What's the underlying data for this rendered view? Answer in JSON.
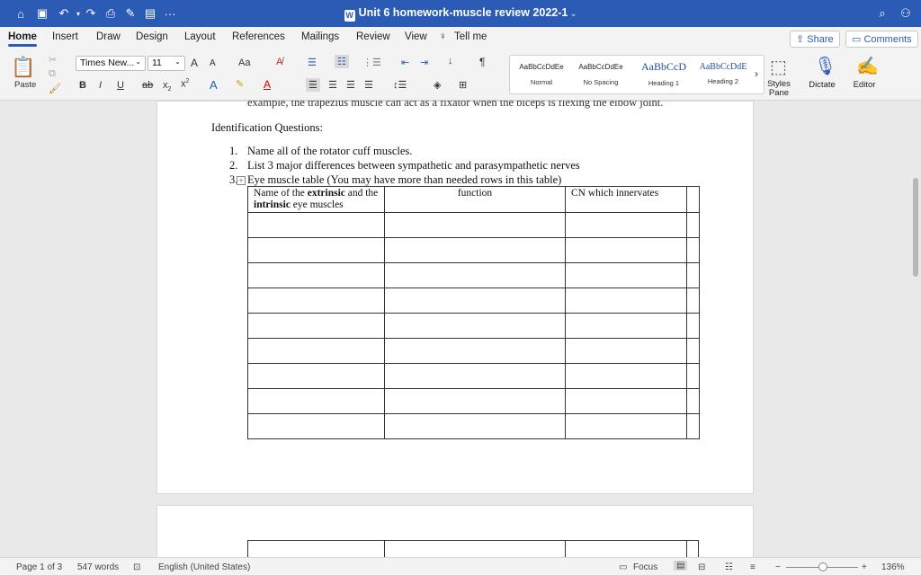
{
  "window": {
    "title": "Unit 6 homework-muscle review 2022-1"
  },
  "quick_access": {
    "icons": [
      "home-icon",
      "save-icon",
      "undo-icon",
      "redo-icon",
      "print-icon",
      "draw-icon",
      "format-icon",
      "more-icon"
    ],
    "more_label": "···"
  },
  "tabs": [
    "Home",
    "Insert",
    "Draw",
    "Design",
    "Layout",
    "References",
    "Mailings",
    "Review",
    "View"
  ],
  "tell_me": "Tell me",
  "share_label": "Share",
  "comments_label": "Comments",
  "ribbon": {
    "paste_label": "Paste",
    "font_name": "Times New...",
    "font_size": "11",
    "bold": "B",
    "italic": "I",
    "underline": "U",
    "strike": "ab",
    "subscript": "x",
    "superscript": "x",
    "grow": "A",
    "shrink": "A",
    "change_case": "Aa",
    "styles": [
      {
        "sample": "AaBbCcDdEe",
        "name": "Normal"
      },
      {
        "sample": "AaBbCcDdEe",
        "name": "No Spacing"
      },
      {
        "sample": "AaBbCcD",
        "name": "Heading 1"
      },
      {
        "sample": "AaBbCcDdE",
        "name": "Heading 2"
      }
    ],
    "styles_pane_label": "Styles\nPane",
    "dictate_label": "Dictate",
    "editor_label": "Editor",
    "pilcrow": "¶"
  },
  "document": {
    "cut_line": "example, the trapezius muscle can act as a fixator when the biceps is flexing the elbow joint.",
    "heading": "Identification Questions:",
    "questions": [
      {
        "num": "1.",
        "text": "Name all of the rotator cuff muscles."
      },
      {
        "num": "2.",
        "text": "List 3 major differences between sympathetic and parasympathetic nerves"
      },
      {
        "num": "3.",
        "text": "Eye muscle table (You may have more than needed rows in this table)"
      }
    ],
    "table": {
      "header_col1_part1": "Name of the ",
      "header_col1_bold1": "extrinsic",
      "header_col1_part2": " and the ",
      "header_col1_bold2": "intrinsic",
      "header_col1_part3": " eye muscles",
      "header_col2": "function",
      "header_col3": "CN which innervates",
      "empty_rows": 9
    }
  },
  "status": {
    "page": "Page 1 of 3",
    "words": "547 words",
    "language": "English (United States)",
    "focus": "Focus",
    "zoom": "136%"
  }
}
